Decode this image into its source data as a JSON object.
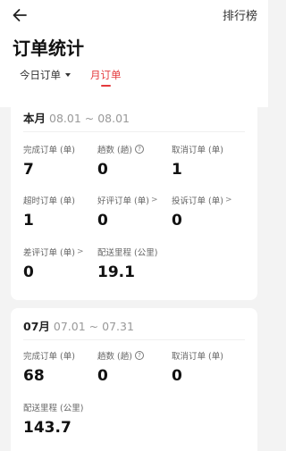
{
  "header": {
    "rank_label": "排行榜",
    "title": "订单统计"
  },
  "tabs": [
    {
      "label": "今日订单"
    },
    {
      "label": "月订单"
    }
  ],
  "cards": [
    {
      "month": "本月",
      "range": "08.01 ~ 08.01",
      "stats": [
        {
          "label": "完成订单 (单)",
          "value": "7"
        },
        {
          "label": "趟数 (趟)",
          "value": "0"
        },
        {
          "label": "取消订单 (单)",
          "value": "1"
        },
        {
          "label": "超时订单 (单)",
          "value": "1"
        },
        {
          "label": "好评订单 (单)",
          "value": "0"
        },
        {
          "label": "投诉订单 (单)",
          "value": "0"
        },
        {
          "label": "差评订单 (单)",
          "value": "0"
        },
        {
          "label": "配送里程 (公里)",
          "value": "19.1"
        }
      ]
    },
    {
      "month": "07月",
      "range": "07.01 ~ 07.31",
      "stats": [
        {
          "label": "完成订单 (单)",
          "value": "68"
        },
        {
          "label": "趟数 (趟)",
          "value": "0"
        },
        {
          "label": "取消订单 (单)",
          "value": "0"
        },
        {
          "label": "配送里程 (公里)",
          "value": "143.7"
        }
      ]
    }
  ],
  "colors": {
    "accent": "#e4393c",
    "background": "#f3f3f3",
    "card": "#ffffff"
  },
  "icons": {
    "back": "back-arrow-icon",
    "help": "question-circle-icon",
    "more": "chevron-right-icon",
    "dropdown": "caret-down-icon"
  }
}
